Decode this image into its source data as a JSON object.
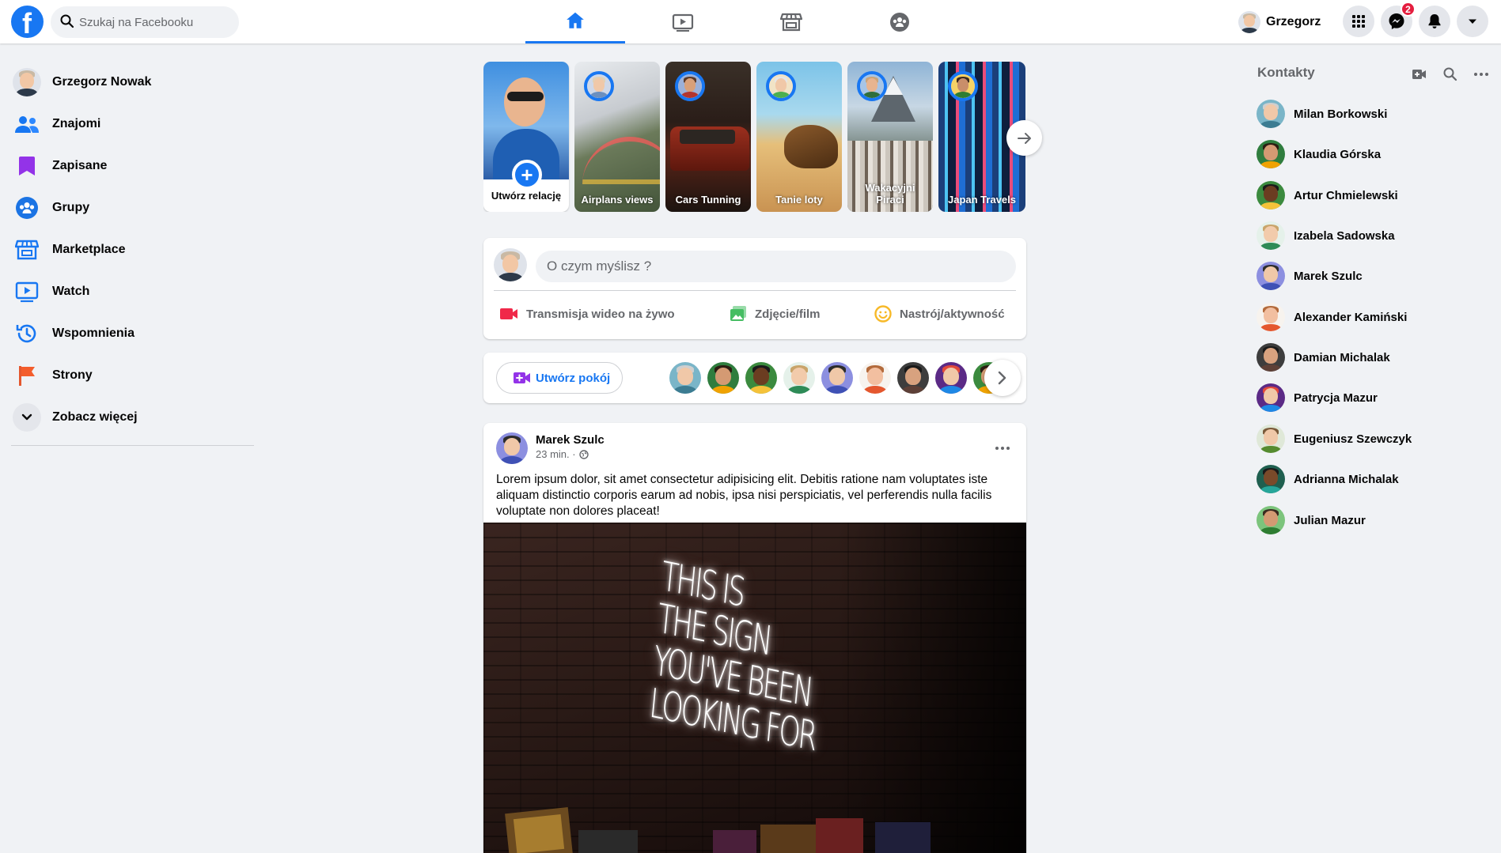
{
  "colors": {
    "accent": "#1877f2",
    "badge": "#e41e3f",
    "secondary_text": "#65676b"
  },
  "header": {
    "logo_letter": "f",
    "search_placeholder": "Szukaj na Facebooku",
    "nav_tabs": [
      {
        "name": "home",
        "icon": "home-icon",
        "active": true
      },
      {
        "name": "watch",
        "icon": "video-icon",
        "active": false
      },
      {
        "name": "marketplace",
        "icon": "store-icon",
        "active": false
      },
      {
        "name": "groups",
        "icon": "groups-icon",
        "active": false
      }
    ],
    "user_name": "Grzegorz",
    "messenger_badge": "2"
  },
  "sidebar": {
    "items": [
      {
        "label": "Grzegorz Nowak",
        "icon": "profile-avatar"
      },
      {
        "label": "Znajomi",
        "icon": "friends-icon"
      },
      {
        "label": "Zapisane",
        "icon": "bookmark-icon"
      },
      {
        "label": "Grupy",
        "icon": "groups-icon"
      },
      {
        "label": "Marketplace",
        "icon": "store-icon"
      },
      {
        "label": "Watch",
        "icon": "video-icon"
      },
      {
        "label": "Wspomnienia",
        "icon": "clock-icon"
      },
      {
        "label": "Strony",
        "icon": "flag-icon"
      },
      {
        "label": "Zobacz więcej",
        "icon": "chevron-down-icon"
      }
    ]
  },
  "stories": {
    "create_label": "Utwórz relację",
    "items": [
      {
        "name": "Airplans views"
      },
      {
        "name": "Cars Tunning"
      },
      {
        "name": "Tanie loty"
      },
      {
        "name": "Wakacyjni Piraci"
      },
      {
        "name": "Japan Travels"
      }
    ]
  },
  "composer": {
    "placeholder": "O czym myślisz ?",
    "actions": [
      {
        "label": "Transmisja wideo na żywo",
        "icon": "live-video-icon",
        "color": "#f02849"
      },
      {
        "label": "Zdjęcie/film",
        "icon": "photo-icon",
        "color": "#45bd62"
      },
      {
        "label": "Nastrój/aktywność",
        "icon": "smiley-icon",
        "color": "#f7b928"
      }
    ]
  },
  "rooms": {
    "create_label": "Utwórz pokój"
  },
  "post": {
    "author": "Marek Szulc",
    "time": "23 min. ·",
    "text": "Lorem ipsum dolor, sit amet consectetur adipisicing elit. Debitis ratione nam voluptates iste aliquam distinctio corporis earum ad nobis, ipsa nisi perspiciatis, vel perferendis nulla facilis voluptate non dolores placeat!",
    "image_neon_lines": [
      "THIS IS",
      "THE SIGN",
      "YOU'VE BEEN",
      "LOOKING FOR"
    ]
  },
  "contacts": {
    "title": "Kontakty",
    "people": [
      "Milan Borkowski",
      "Klaudia Górska",
      "Artur Chmielewski",
      "Izabela Sadowska",
      "Marek Szulc",
      "Alexander Kamiński",
      "Damian Michalak",
      "Patrycja Mazur",
      "Eugeniusz Szewczyk",
      "Adrianna Michalak",
      "Julian Mazur"
    ]
  }
}
